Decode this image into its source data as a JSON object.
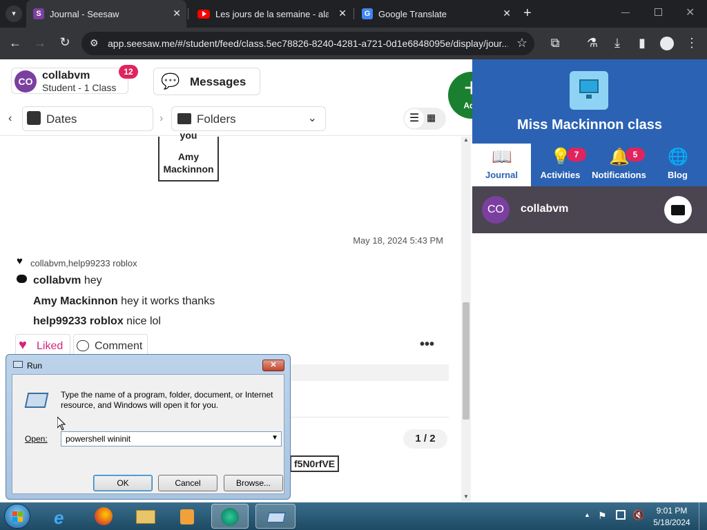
{
  "browser": {
    "tabs": [
      {
        "title": "Journal - Seesaw",
        "favicon": "S"
      },
      {
        "title": "Les jours de la semaine - alain",
        "favicon": "youtube"
      },
      {
        "title": "Google Translate",
        "favicon": "G"
      }
    ],
    "url": "app.seesaw.me/#/student/feed/class.5ec78826-8240-4281-a721-0d1e6848095e/display/jour..."
  },
  "header": {
    "user_initials": "CO",
    "user_name": "collabvm",
    "user_role": "Student - 1 Class",
    "user_badge": "12",
    "messages_label": "Messages",
    "add_label": "Add"
  },
  "filters": {
    "dates_label": "Dates",
    "folders_label": "Folders"
  },
  "post": {
    "card_text_top": "you",
    "card_text_name": "Amy Mackinnon",
    "timestamp": "May 18, 2024 5:43 PM",
    "likes": "collabvm,help99233 roblox",
    "comments": [
      {
        "author": "collabvm",
        "text": "hey"
      },
      {
        "author": "Amy Mackinnon",
        "text": "hey it works thanks"
      },
      {
        "author": "help99233 roblox",
        "text": "nice lol"
      }
    ],
    "liked_label": "Liked",
    "comment_label": "Comment",
    "page_indicator": "1 / 2",
    "code_fragment": "f5N0rfVE"
  },
  "class_panel": {
    "title": "Miss Mackinnon class",
    "nav": [
      {
        "label": "Journal",
        "badge": ""
      },
      {
        "label": "Activities",
        "badge": "7"
      },
      {
        "label": "Notifications",
        "badge": "5"
      },
      {
        "label": "Blog",
        "badge": ""
      }
    ],
    "student_initials": "CO",
    "student_name": "collabvm"
  },
  "run_dialog": {
    "title": "Run",
    "description": "Type the name of a program, folder, document, or Internet resource, and Windows will open it for you.",
    "open_label": "Open:",
    "open_value": "powershell wininit",
    "ok_label": "OK",
    "cancel_label": "Cancel",
    "browse_label": "Browse..."
  },
  "taskbar": {
    "time": "9:01 PM",
    "date": "5/18/2024"
  },
  "colors": {
    "seesaw_blue": "#2c62b3",
    "seesaw_green": "#1a7f2e",
    "like_pink": "#d6247a",
    "badge_red": "#e0245e"
  }
}
